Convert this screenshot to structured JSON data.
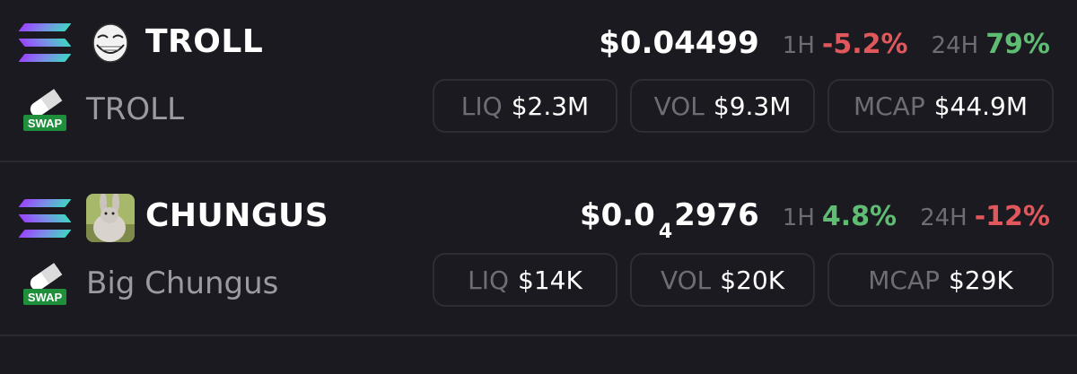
{
  "tokens": [
    {
      "chain_icon": "solana-icon",
      "dex_icon": "swap-icon",
      "dex_label": "SWAP",
      "logo_icon": "troll-face-icon",
      "symbol": "TROLL",
      "name": "TROLL",
      "price": "$0.04499",
      "price_subscript": "",
      "price_tail": "",
      "change_1h_label": "1H",
      "change_1h": "-5.2%",
      "change_1h_color": "#e0585c",
      "change_24h_label": "24H",
      "change_24h": "79%",
      "change_24h_color": "#5fbd73",
      "liq_label": "LIQ",
      "liq": "$2.3M",
      "vol_label": "VOL",
      "vol": "$9.3M",
      "mcap_label": "MCAP",
      "mcap": "$44.9M"
    },
    {
      "chain_icon": "solana-icon",
      "dex_icon": "swap-icon",
      "dex_label": "SWAP",
      "logo_icon": "chungus-icon",
      "symbol": "CHUNGUS",
      "name": "Big Chungus",
      "price": "$0.0",
      "price_subscript": "4",
      "price_tail": "2976",
      "change_1h_label": "1H",
      "change_1h": "4.8%",
      "change_1h_color": "#5fbd73",
      "change_24h_label": "24H",
      "change_24h": "-12%",
      "change_24h_color": "#e0585c",
      "liq_label": "LIQ",
      "liq": "$14K",
      "vol_label": "VOL",
      "vol": "$20K",
      "mcap_label": "MCAP",
      "mcap": "$29K"
    }
  ]
}
